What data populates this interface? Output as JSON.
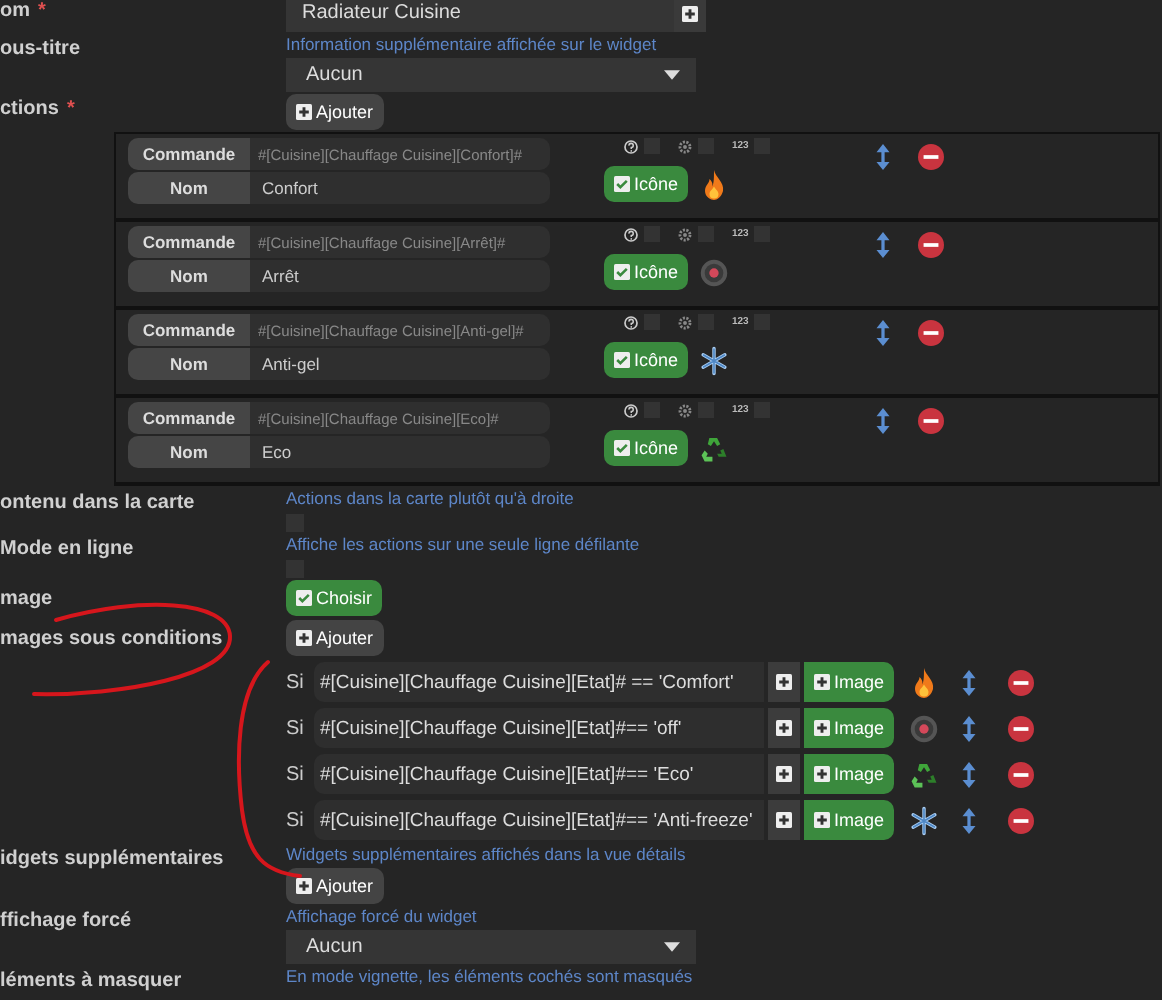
{
  "name_field": {
    "label": "om",
    "required": true,
    "required_mark": "*",
    "value": "Radiateur Cuisine"
  },
  "subtitle_field": {
    "label": "ous-titre",
    "hint": "Information supplémentaire affichée sur le widget",
    "value": "Aucun"
  },
  "actions": {
    "label": "ctions",
    "required": true,
    "required_mark": "*",
    "add_button": "Ajouter",
    "items": [
      {
        "command_label": "Commande",
        "command": "#[Cuisine][Chauffage Cuisine][Confort]#",
        "name_label": "Nom",
        "name": "Confort",
        "help_checked": false,
        "gear_checked": false,
        "numeric_label": "123",
        "numeric_checked": false,
        "icon_button": "Icône",
        "icon_checked": true,
        "kind": "flame"
      },
      {
        "command_label": "Commande",
        "command": "#[Cuisine][Chauffage Cuisine][Arrêt]#",
        "name_label": "Nom",
        "name": "Arrêt",
        "help_checked": false,
        "gear_checked": false,
        "numeric_label": "123",
        "numeric_checked": false,
        "icon_button": "Icône",
        "icon_checked": true,
        "kind": "off"
      },
      {
        "command_label": "Commande",
        "command": "#[Cuisine][Chauffage Cuisine][Anti-gel]#",
        "name_label": "Nom",
        "name": "Anti-gel",
        "help_checked": false,
        "gear_checked": false,
        "numeric_label": "123",
        "numeric_checked": false,
        "icon_button": "Icône",
        "icon_checked": true,
        "kind": "snowflake"
      },
      {
        "command_label": "Commande",
        "command": "#[Cuisine][Chauffage Cuisine][Eco]#",
        "name_label": "Nom",
        "name": "Eco",
        "help_checked": false,
        "gear_checked": false,
        "numeric_label": "123",
        "numeric_checked": false,
        "icon_button": "Icône",
        "icon_checked": true,
        "kind": "recycle"
      }
    ]
  },
  "content_in_card": {
    "label": "ontenu dans la carte",
    "hint": "Actions dans la carte plutôt qu'à droite",
    "checked": false
  },
  "inline_mode": {
    "label": "Mode en ligne",
    "hint": "Affiche les actions sur une seule ligne défilante",
    "checked": false
  },
  "image": {
    "label": "mage",
    "button": "Choisir",
    "checked": true
  },
  "conditional_images": {
    "label": "mages sous conditions",
    "add_button": "Ajouter",
    "rows": [
      {
        "prefix": "Si",
        "condition": "#[Cuisine][Chauffage Cuisine][Etat]# == 'Comfort'",
        "image_button": "Image",
        "kind": "flame"
      },
      {
        "prefix": "Si",
        "condition": "#[Cuisine][Chauffage Cuisine][Etat]#== 'off'",
        "image_button": "Image",
        "kind": "off"
      },
      {
        "prefix": "Si",
        "condition": "#[Cuisine][Chauffage Cuisine][Etat]#== 'Eco'",
        "image_button": "Image",
        "kind": "recycle"
      },
      {
        "prefix": "Si",
        "condition": "#[Cuisine][Chauffage Cuisine][Etat]#== 'Anti-freeze'",
        "image_button": "Image",
        "kind": "snowflake"
      }
    ]
  },
  "extra_widgets": {
    "label": "idgets supplémentaires",
    "hint": "Widgets supplémentaires affichés dans la vue détails",
    "add_button": "Ajouter"
  },
  "forced_display": {
    "label": "ffichage forcé",
    "hint": "Affichage forcé du widget",
    "value": "Aucun"
  },
  "hidden_elements": {
    "label": "léments à masquer",
    "hint": "En mode vignette, les éléments cochés sont masqués"
  }
}
